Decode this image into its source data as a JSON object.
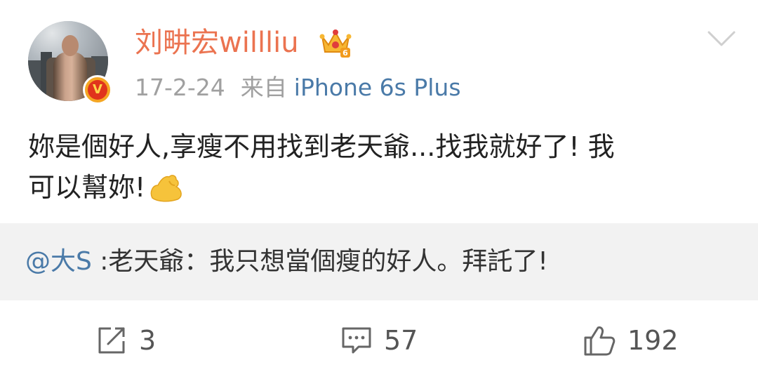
{
  "post": {
    "author": "刘畊宏willliu",
    "timestamp": "17-2-24",
    "source_prefix": "来自",
    "source": "iPhone 6s Plus",
    "content_line1": "妳是個好人,享瘦不用找到老天爺...找我就好了! 我",
    "content_line2": "可以幫妳!",
    "content_emoji": "flexed-biceps"
  },
  "repost": {
    "mention": "@大S",
    "text": " :老天爺：我只想當個瘦的好人。拜託了!"
  },
  "actions": {
    "repost_count": "3",
    "comment_count": "57",
    "like_count": "192"
  },
  "colors": {
    "username": "#eb7350",
    "link": "#4a7aa8",
    "meta": "#a0a0a0",
    "repost_bg": "#f2f2f2"
  }
}
